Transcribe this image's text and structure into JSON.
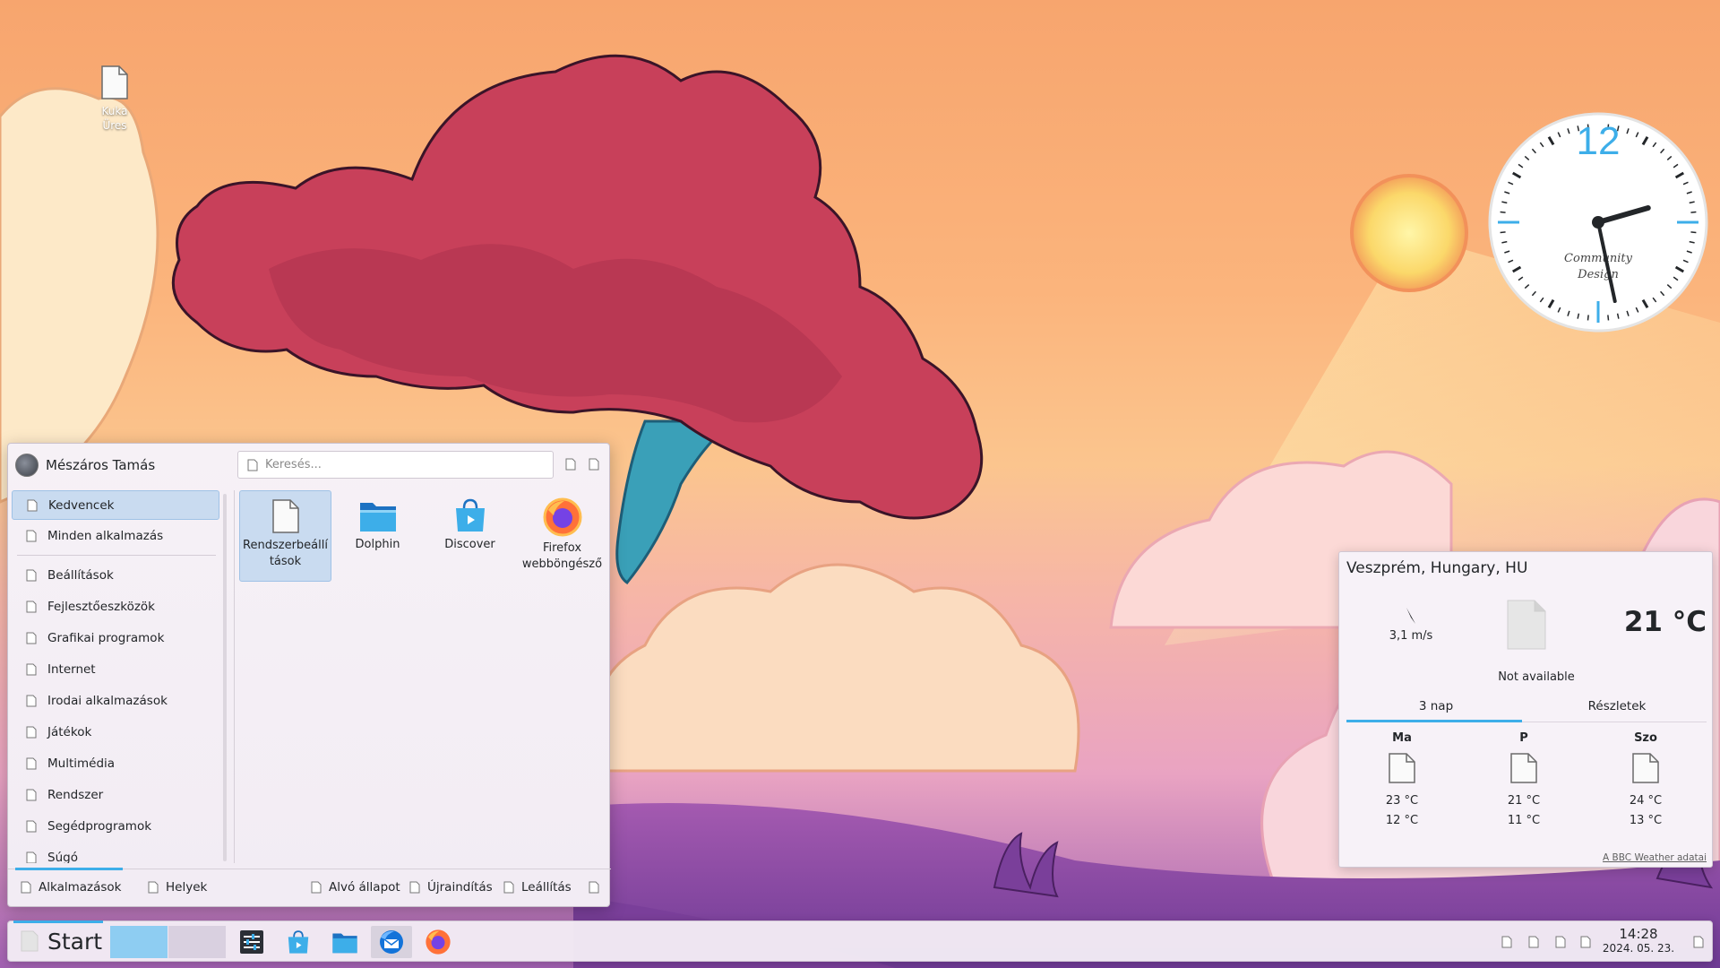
{
  "desktop": {
    "trash_label": "Kuka",
    "trash_status": "Üres"
  },
  "clock": {
    "twelve": "12",
    "brand_line1": "Community",
    "brand_line2": "Design",
    "time_hour": 14,
    "time_minute": 28
  },
  "launcher": {
    "user_name": "Mészáros Tamás",
    "search_placeholder": "Keresés...",
    "header_icons": [
      "configure-icon",
      "pin-icon"
    ],
    "categories": [
      {
        "label": "Kedvencek",
        "active": true
      },
      {
        "label": "Minden alkalmazás"
      },
      {
        "label": "Beállítások"
      },
      {
        "label": "Fejlesztőeszközök"
      },
      {
        "label": "Grafikai programok"
      },
      {
        "label": "Internet"
      },
      {
        "label": "Irodai alkalmazások"
      },
      {
        "label": "Játékok"
      },
      {
        "label": "Multimédia"
      },
      {
        "label": "Rendszer"
      },
      {
        "label": "Segédprogramok"
      },
      {
        "label": "Súgó"
      }
    ],
    "favorites": [
      {
        "line1": "Rendszerbeállí",
        "line2": "tások",
        "icon": "document-icon",
        "selected": true
      },
      {
        "line1": "Dolphin",
        "line2": "",
        "icon": "folder-icon"
      },
      {
        "line1": "Discover",
        "line2": "",
        "icon": "store-bag-icon"
      },
      {
        "line1": "Firefox",
        "line2": "webböngésző",
        "icon": "firefox-icon"
      }
    ],
    "footer": {
      "tab_apps": "Alkalmazások",
      "tab_places": "Helyek",
      "sleep": "Alvó állapot",
      "restart": "Újraindítás",
      "shutdown": "Leállítás"
    }
  },
  "weather": {
    "location": "Veszprém, Hungary, HU",
    "wind": "3,1 m/s",
    "condition": "Not available",
    "temperature": "21 °C",
    "tab_forecast": "3 nap",
    "tab_details": "Részletek",
    "days": [
      {
        "name": "Ma",
        "high": "23 °C",
        "low": "12 °C"
      },
      {
        "name": "P",
        "high": "21 °C",
        "low": "11 °C"
      },
      {
        "name": "Szo",
        "high": "24 °C",
        "low": "13 °C"
      }
    ],
    "credit": "A BBC Weather adatai"
  },
  "taskbar": {
    "start_label": "Start",
    "time": "14:28",
    "date": "2024. 05. 23.",
    "apps": [
      "system-monitor-icon",
      "discover-icon",
      "dolphin-icon",
      "thunderbird-icon",
      "firefox-icon"
    ],
    "colors": {
      "accent": "#3daee9"
    }
  }
}
